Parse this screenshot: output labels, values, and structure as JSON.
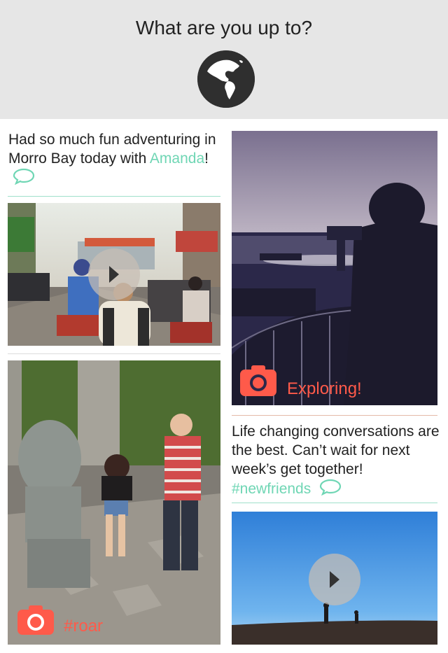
{
  "header": {
    "title": "What are you up to?",
    "icon": "globe-icon"
  },
  "posts": [
    {
      "text_before": "Had so much fun adventuring in Morro Bay today with ",
      "mention": "Amanda",
      "text_after": "!",
      "icon": "comment-icon"
    },
    {
      "text": "Life changing conversations are the best. Can’t wait for next week’s get together!",
      "hashtag": "#newfriends",
      "icon": "comment-icon"
    }
  ],
  "media": [
    {
      "kind": "video",
      "icon": "play-icon"
    },
    {
      "kind": "photo",
      "caption": "Exploring!",
      "icon": "camera-icon"
    },
    {
      "kind": "photo",
      "caption": "#roar",
      "icon": "camera-icon"
    },
    {
      "kind": "video",
      "icon": "play-icon"
    }
  ],
  "colors": {
    "accent_teal": "#6fd6b4",
    "accent_coral": "#ff5a4a",
    "header_bg": "#e6e6e6"
  }
}
